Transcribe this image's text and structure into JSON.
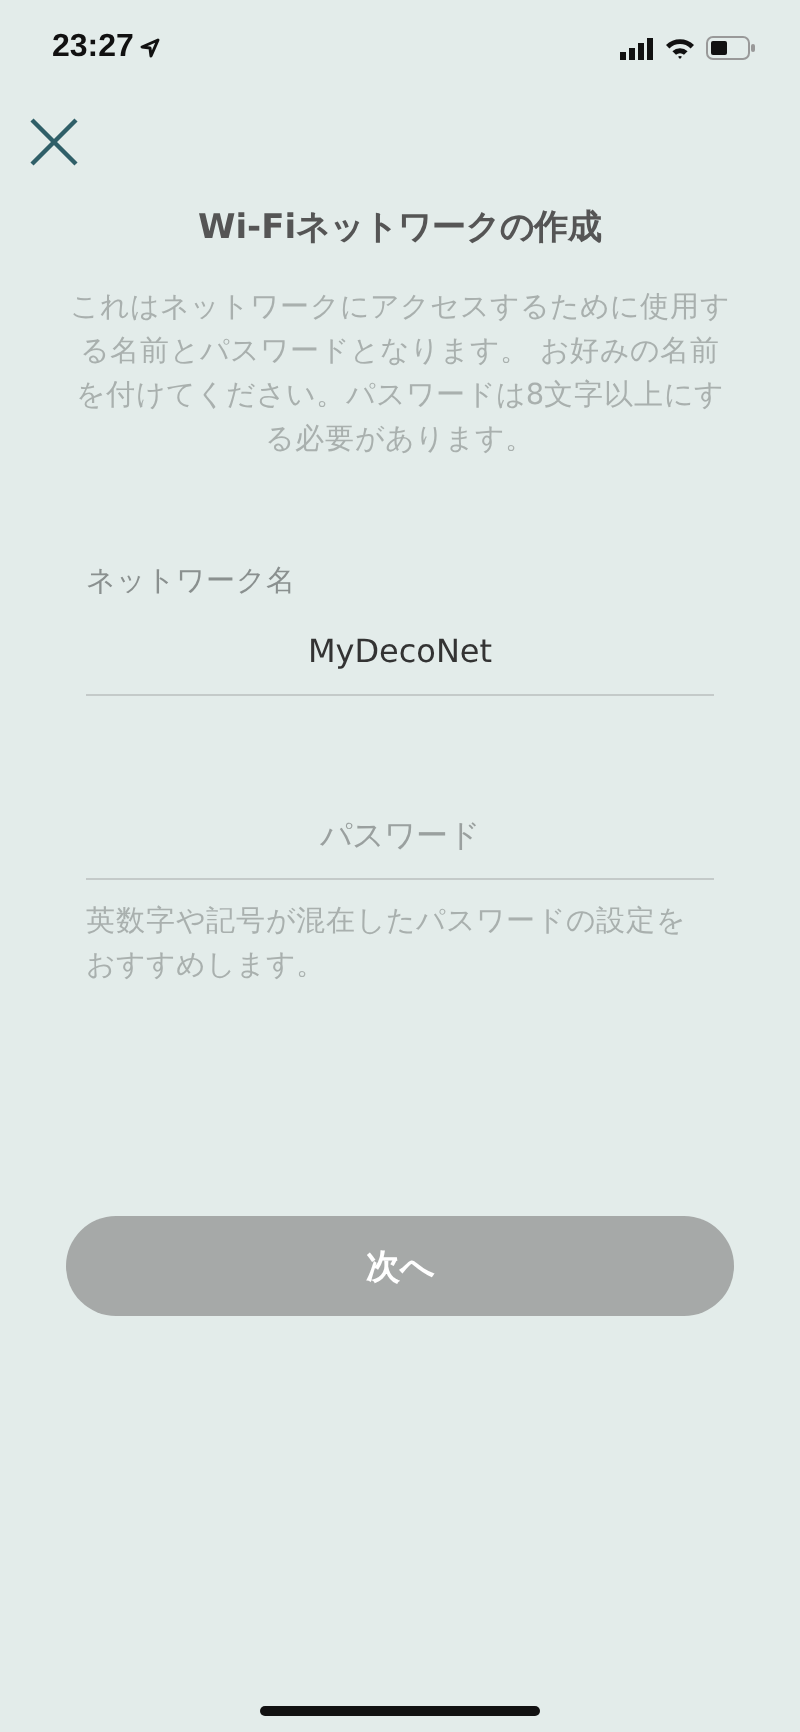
{
  "status_bar": {
    "time": "23:27"
  },
  "title": "Wi-Fiネットワークの作成",
  "description": "これはネットワークにアクセスするために使用する名前とパスワードとなります。 お好みの名前を付けてください。パスワードは8文字以上にする必要があります。",
  "network_name": {
    "label": "ネットワーク名",
    "value": "MyDecoNet"
  },
  "password": {
    "placeholder": "パスワード"
  },
  "hint": "英数字や記号が混在したパスワードの設定をおすすめします。",
  "next_button": {
    "label": "次へ",
    "disabled": true
  }
}
